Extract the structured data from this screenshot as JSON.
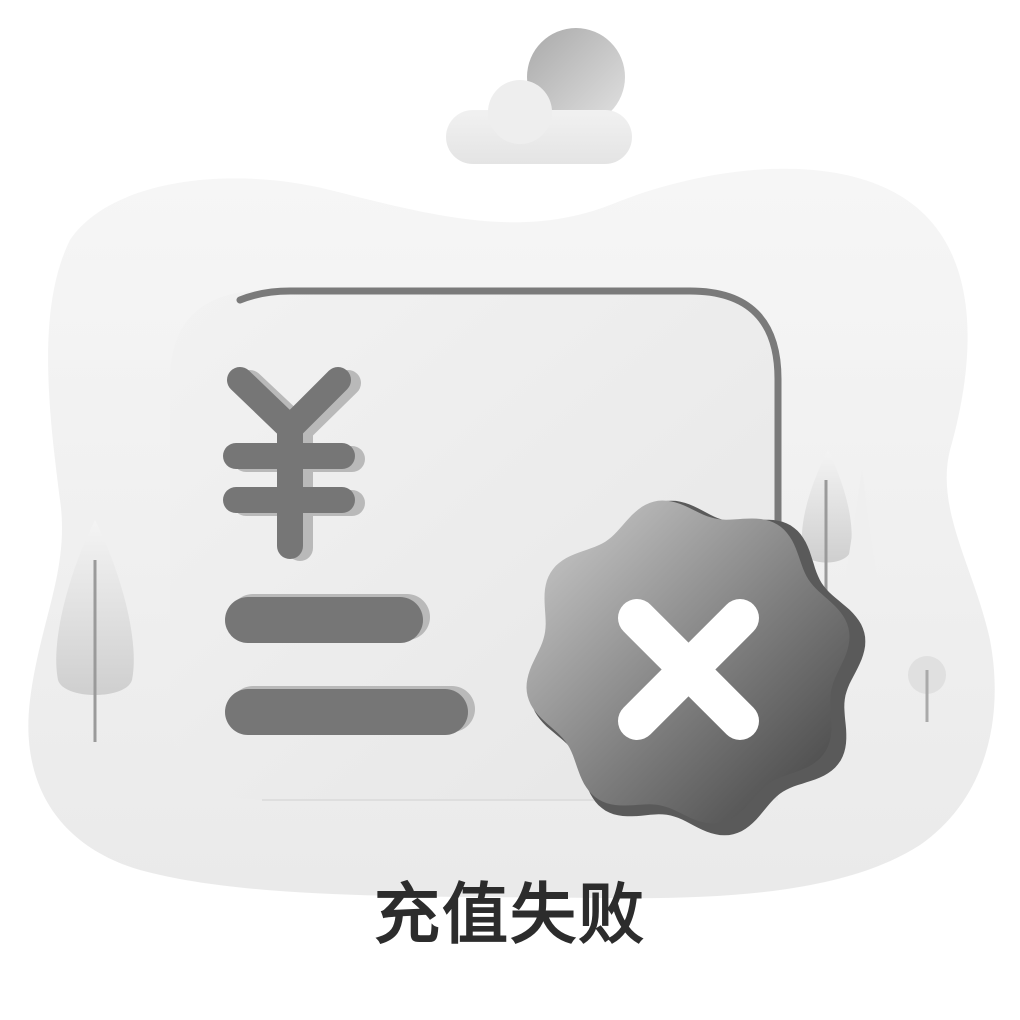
{
  "status": {
    "message": "充值失败",
    "state": "failed"
  },
  "icons": {
    "card": "recharge-card-icon",
    "currency": "yuan-icon",
    "badge": "failure-badge-icon",
    "mark": "close-icon"
  },
  "colors": {
    "background": "#ffffff",
    "blob": "#efefef",
    "card_fill": "#ebebeb",
    "card_outline": "#7a7a7a",
    "symbol": "#767676",
    "badge_dark": "#4a4a4a",
    "badge_light": "#c8c8c8",
    "mark": "#ffffff",
    "caption": "#2c2c2c"
  }
}
